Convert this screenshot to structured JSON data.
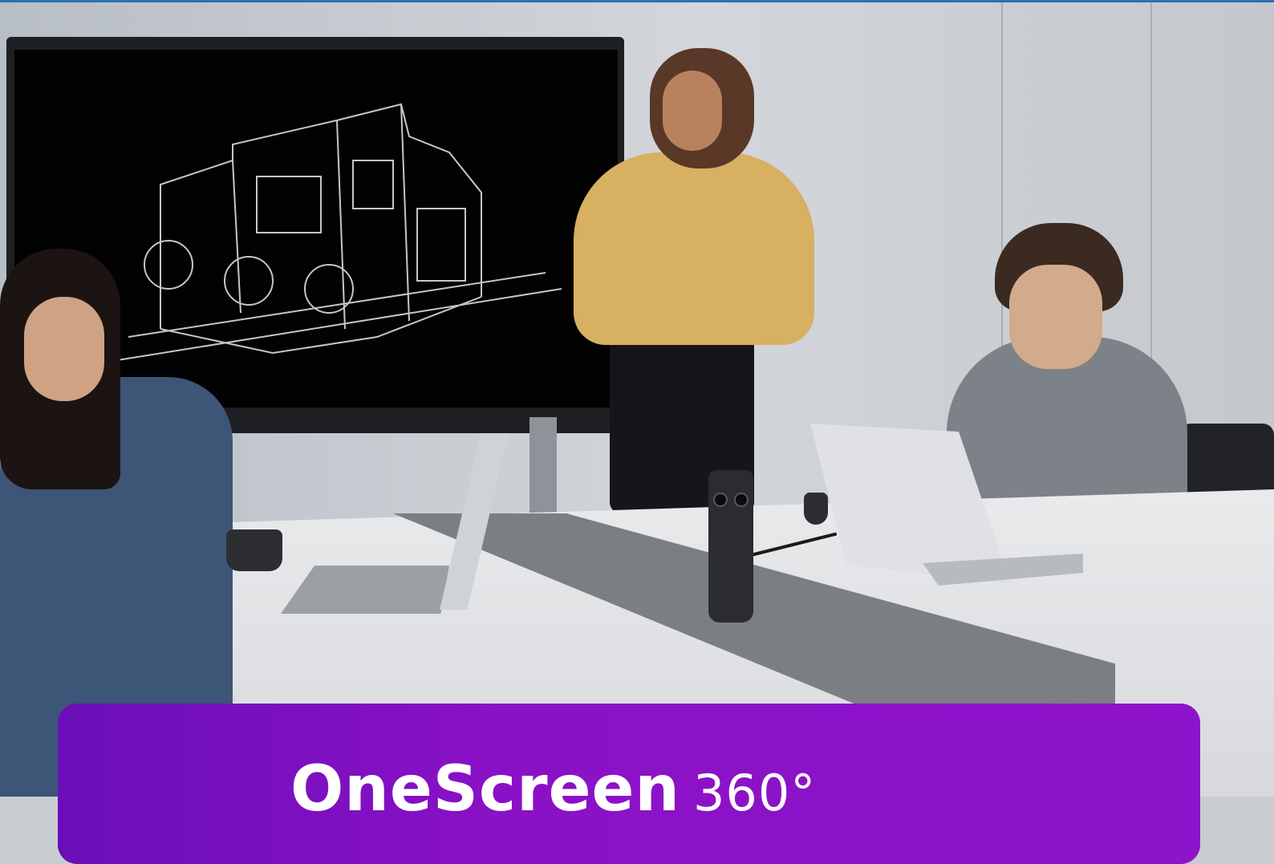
{
  "banner": {
    "brand": "OneScreen",
    "model": "360°"
  },
  "colors": {
    "banner_start": "#6a0fb8",
    "banner_end": "#8e14cb",
    "top_strip": "#2f6fb6"
  },
  "image": {
    "scene": "meeting-room-photo",
    "product": "360-camera"
  }
}
